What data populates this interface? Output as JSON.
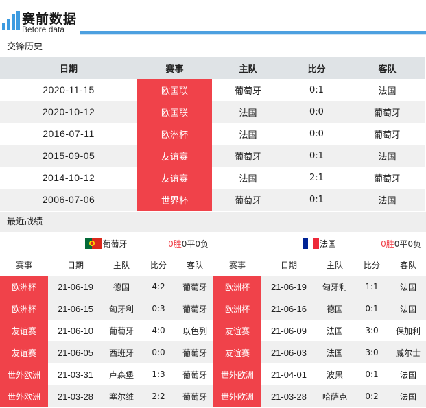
{
  "header": {
    "title": "赛前数据",
    "subtitle": "Before data",
    "accent_color": "#4da0e0"
  },
  "h2h": {
    "section_label": "交锋历史",
    "columns": [
      "日期",
      "赛事",
      "主队",
      "比分",
      "客队"
    ],
    "rows": [
      [
        "2020-11-15",
        "欧国联",
        "葡萄牙",
        "0:1",
        "法国"
      ],
      [
        "2020-10-12",
        "欧国联",
        "法国",
        "0:0",
        "葡萄牙"
      ],
      [
        "2016-07-11",
        "欧洲杯",
        "法国",
        "0:0",
        "葡萄牙"
      ],
      [
        "2015-09-05",
        "友谊赛",
        "葡萄牙",
        "0:1",
        "法国"
      ],
      [
        "2014-10-12",
        "友谊赛",
        "法国",
        "2:1",
        "葡萄牙"
      ],
      [
        "2006-07-06",
        "世界杯",
        "葡萄牙",
        "0:1",
        "法国"
      ]
    ]
  },
  "recent": {
    "section_label": "最近战绩",
    "columns": [
      "赛事",
      "日期",
      "主队",
      "比分",
      "客队"
    ],
    "left": {
      "team": "葡萄牙",
      "flag_icon": "portugal-flag-icon",
      "wins": "0胜",
      "draws": "0平",
      "losses": "0负",
      "rows": [
        [
          "欧洲杯",
          "21-06-19",
          "德国",
          "4:2",
          "葡萄牙"
        ],
        [
          "欧洲杯",
          "21-06-15",
          "匈牙利",
          "0:3",
          "葡萄牙"
        ],
        [
          "友谊赛",
          "21-06-10",
          "葡萄牙",
          "4:0",
          "以色列"
        ],
        [
          "友谊赛",
          "21-06-05",
          "西班牙",
          "0:0",
          "葡萄牙"
        ],
        [
          "世外欧洲",
          "21-03-31",
          "卢森堡",
          "1:3",
          "葡萄牙"
        ],
        [
          "世外欧洲",
          "21-03-28",
          "塞尔维",
          "2:2",
          "葡萄牙"
        ]
      ]
    },
    "right": {
      "team": "法国",
      "flag_icon": "france-flag-icon",
      "wins": "0胜",
      "draws": "0平",
      "losses": "0负",
      "rows": [
        [
          "欧洲杯",
          "21-06-19",
          "匈牙利",
          "1:1",
          "法国"
        ],
        [
          "欧洲杯",
          "21-06-16",
          "德国",
          "0:1",
          "法国"
        ],
        [
          "友谊赛",
          "21-06-09",
          "法国",
          "3:0",
          "保加利"
        ],
        [
          "友谊赛",
          "21-06-03",
          "法国",
          "3:0",
          "威尔士"
        ],
        [
          "世外欧洲",
          "21-04-01",
          "波黑",
          "0:1",
          "法国"
        ],
        [
          "世外欧洲",
          "21-03-28",
          "哈萨克",
          "0:2",
          "法国"
        ]
      ]
    }
  },
  "colors": {
    "competition_bg": "#f0424a",
    "header_row_bg": "#dfe3e6",
    "alt_row_bg": "#f0f0f0"
  }
}
